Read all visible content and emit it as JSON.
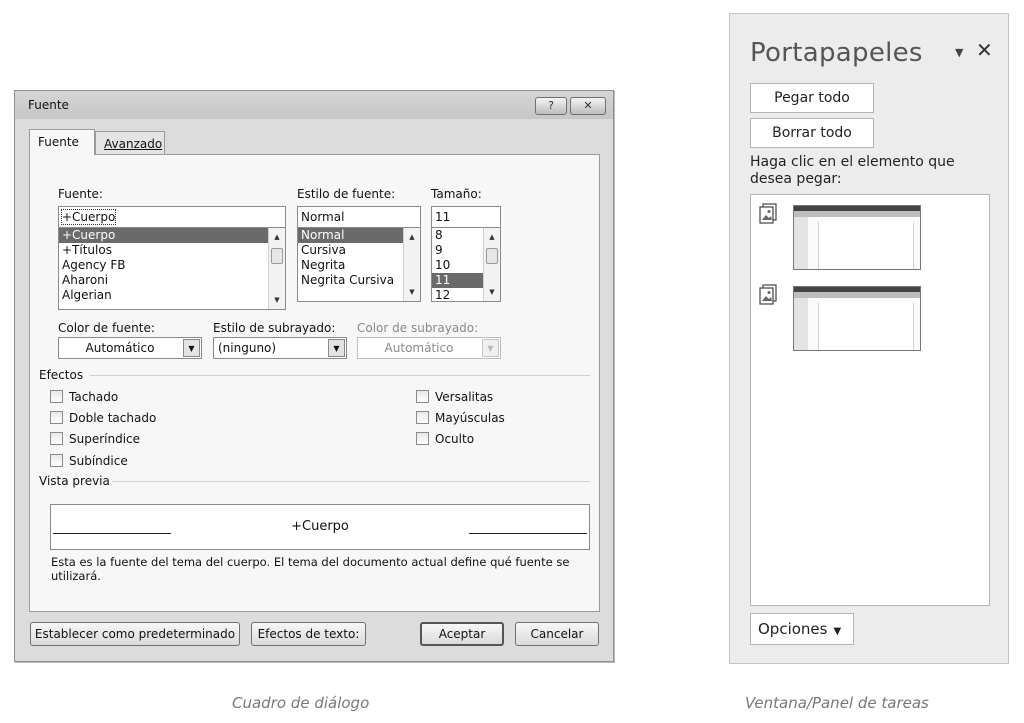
{
  "dialog": {
    "title": "Fuente",
    "help_glyph": "?",
    "close_glyph": "✕",
    "tabs": [
      "Fuente",
      "Avanzado"
    ],
    "font_label": "Fuente:",
    "font_value": "+Cuerpo",
    "font_list": [
      "+Cuerpo",
      "+Títulos",
      "Agency FB",
      "Aharoni",
      "Algerian"
    ],
    "style_label": "Estilo de fuente:",
    "style_value": "Normal",
    "style_list": [
      "Normal",
      "Cursiva",
      "Negrita",
      "Negrita Cursiva"
    ],
    "size_label": "Tamaño:",
    "size_value": "11",
    "size_list": [
      "8",
      "9",
      "10",
      "11",
      "12"
    ],
    "font_color_label": "Color de fuente:",
    "font_color_value": "Automático",
    "underline_style_label": "Estilo de subrayado:",
    "underline_style_value": "(ninguno)",
    "underline_color_label": "Color de subrayado:",
    "underline_color_value": "Automático",
    "effects_label": "Efectos",
    "effects_left": [
      "Tachado",
      "Doble tachado",
      "Superíndice",
      "Subíndice"
    ],
    "effects_right": [
      "Versalitas",
      "Mayúsculas",
      "Oculto"
    ],
    "preview_label": "Vista previa",
    "preview_text": "+Cuerpo",
    "preview_note": "Esta es la fuente del tema del cuerpo. El tema del documento actual define qué fuente se utilizará.",
    "buttons": {
      "set_default": "Establecer como predeterminado",
      "text_effects": "Efectos de texto:",
      "ok": "Aceptar",
      "cancel": "Cancelar"
    }
  },
  "captions": {
    "dialog": "Cuadro de diálogo",
    "pane": "Ventana/Panel de tareas"
  },
  "pane": {
    "title": "Portapapeles",
    "menu_glyph": "▼",
    "close_glyph": "✕",
    "paste_all": "Pegar todo",
    "clear_all": "Borrar todo",
    "instruction": "Haga clic en el elemento que desea pegar:",
    "options": "Opciones",
    "options_glyph": "▼"
  }
}
